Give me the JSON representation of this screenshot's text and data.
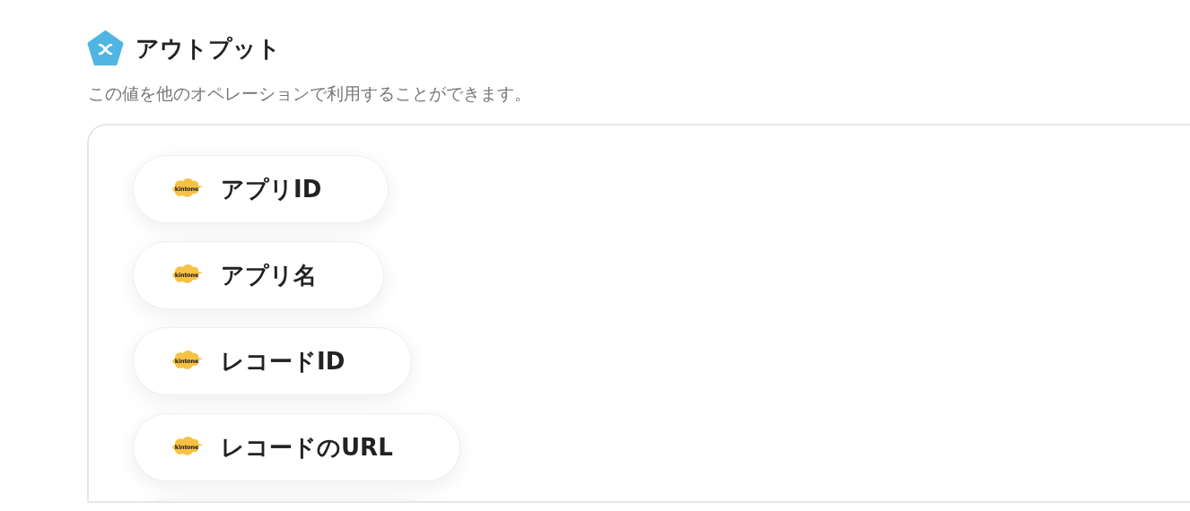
{
  "section": {
    "title": "アウトプット",
    "description": "この値を他のオペレーションで利用することができます。"
  },
  "outputs": [
    {
      "label": "アプリID",
      "logo_text": "kintone"
    },
    {
      "label": "アプリ名",
      "logo_text": "kintone"
    },
    {
      "label": "レコードID",
      "logo_text": "kintone"
    },
    {
      "label": "レコードのURL",
      "logo_text": "kintone"
    }
  ]
}
